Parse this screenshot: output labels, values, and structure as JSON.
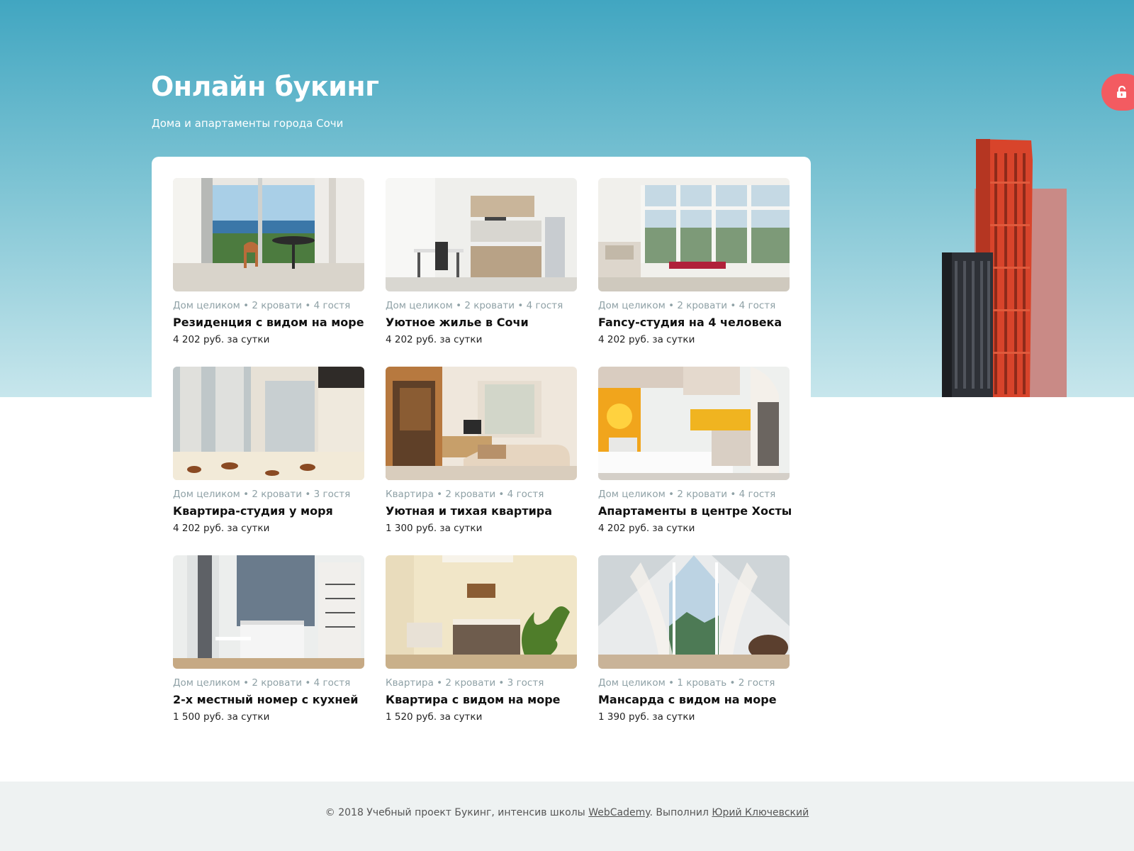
{
  "header": {
    "title": "Онлайн букинг",
    "subtitle": "Дома и апартаменты города Сочи"
  },
  "unlock_button": {
    "icon": "lock-open-icon",
    "color": "#f35b61"
  },
  "colors": {
    "sky_top": "#41a6c1",
    "sky_bottom": "#c7e6ec",
    "footer_bg": "#eef2f2",
    "meta_text": "#8fa1a6",
    "accent": "#f35b61"
  },
  "listings": [
    {
      "meta": "Дом целиком • 2 кровати • 4 гостя",
      "name": "Резиденция с видом на море",
      "price": "4 202 руб. за сутки",
      "photo": "sea-view-terrace"
    },
    {
      "meta": "Дом целиком • 2 кровати • 4 гостя",
      "name": "Уютное жилье в Сочи",
      "price": "4 202 руб. за сутки",
      "photo": "kitchen-studio"
    },
    {
      "meta": "Дом целиком • 2 кровати • 4 гостя",
      "name": "Fancy-студия на 4 человека",
      "price": "4 202 руб. за сутки",
      "photo": "glazed-balcony"
    },
    {
      "meta": "Дом целиком • 2 кровати • 3 гостя",
      "name": "Квартира-студия у моря",
      "price": "4 202 руб. за сутки",
      "photo": "bedroom-curtains"
    },
    {
      "meta": "Квартира  • 2 кровати • 4 гостя",
      "name": "Уютная и тихая квартира",
      "price": "1 300 руб. за сутки",
      "photo": "living-room"
    },
    {
      "meta": "Дом целиком • 2 кровати • 4 гостя",
      "name": "Апартаменты в центре Хосты",
      "price": "4 202 руб. за сутки",
      "photo": "bright-kitchen"
    },
    {
      "meta": "Дом целиком • 2 кровати • 4 гостя",
      "name": "2-х местный номер с кухней",
      "price": "1 500 руб. за сутки",
      "photo": "room-with-kitchen"
    },
    {
      "meta": "Квартира • 2 кровати • 3 гостя",
      "name": "Квартира с видом на море",
      "price": "1 520 руб. за сутки",
      "photo": "bedroom-plant"
    },
    {
      "meta": "Дом целиком • 1 кровать • 2 гостя",
      "name": "Мансарда с видом на море",
      "price": "1 390 руб. за сутки",
      "photo": "attic-mountain-view"
    }
  ],
  "footer": {
    "text_before": "© 2018 Учебный проект Букинг, интенсив школы ",
    "link1": "WebCademy",
    "text_middle": ". Выполнил ",
    "link2": "Юрий Ключевский"
  }
}
